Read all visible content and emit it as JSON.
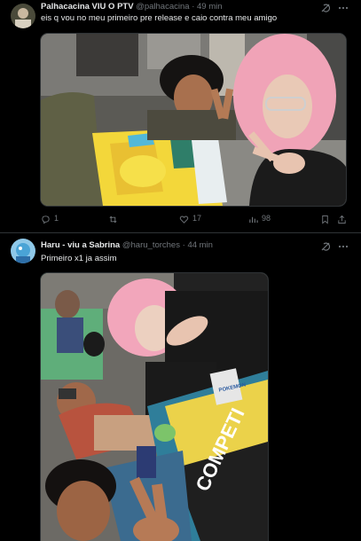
{
  "tweets": [
    {
      "display_name": "Palhacacina VIU O PTV",
      "handle": "@palhacacina",
      "separator": "·",
      "time": "49 min",
      "text": "eis q vou no meu primeiro pre release e caio contra meu amigo",
      "counts": {
        "replies": "1",
        "likes": "17",
        "views": "98"
      },
      "icons": [
        "grok-icon",
        "more-icon",
        "reply-icon",
        "retweet-icon",
        "like-icon",
        "views-icon",
        "bookmark-icon",
        "share-icon"
      ]
    },
    {
      "display_name": "Haru - viu a Sabrina",
      "handle": "@haru_torches",
      "separator": "·",
      "time": "44 min",
      "text": "Primeiro x1 ja assim",
      "media_text": [
        "COMPETI",
        "POKEMON"
      ],
      "icons": [
        "grok-icon",
        "more-icon"
      ]
    }
  ],
  "colors": {
    "background": "#000000",
    "text": "#e7e9ea",
    "secondary": "#71767b",
    "divider": "#2f3336"
  }
}
